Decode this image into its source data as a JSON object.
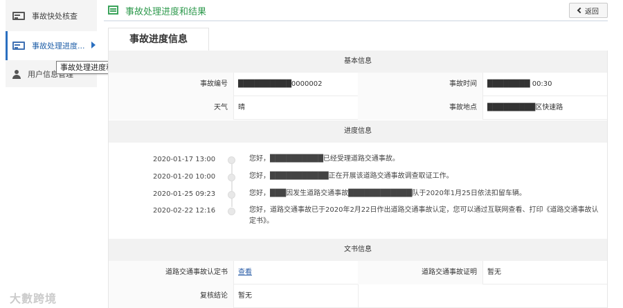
{
  "sidebar": {
    "items": [
      {
        "label": "事故快处核查",
        "icon": "id-card-icon"
      },
      {
        "label": "事故处理进度...",
        "icon": "id-card-icon"
      },
      {
        "label": "用户信息管理",
        "icon": "user-icon"
      }
    ],
    "tooltip": "事故处理进度和结果"
  },
  "header": {
    "title": "事故处理进度和结果",
    "back_label": "返回",
    "accent_color": "#2f9a4e"
  },
  "tab": {
    "label": "事故进度信息"
  },
  "basic": {
    "heading": "基本信息",
    "accident_no_label": "事故编号",
    "accident_no": "██████████0000002",
    "accident_time_label": "事故时间",
    "accident_time": "████████ 00:30",
    "weather_label": "天气",
    "weather": "晴",
    "location_label": "事故地点",
    "location": "█████████区快速路"
  },
  "progress": {
    "heading": "进度信息",
    "items": [
      {
        "date": "2020-01-17 13:00",
        "text": "您好，██████████已经受理道路交通事故。"
      },
      {
        "date": "2020-01-20 10:00",
        "text": "您好，███████████正在开展该道路交通事故调查取证工作。"
      },
      {
        "date": "2020-01-25 09:23",
        "text": "您好，███因发生道路交通事故████████████队于2020年1月25日依法扣留车辆。"
      },
      {
        "date": "2020-02-22 12:16",
        "text": "您好，道路交通事故已于2020年2月22日作出道路交通事故认定，您可以通过互联网查看、打印《道路交通事故认定书》。"
      }
    ]
  },
  "documents": {
    "heading": "文书信息",
    "cert_label": "道路交通事故认定书",
    "cert_value": "查看",
    "proof_label": "道路交通事故证明",
    "proof_value": "暂无",
    "review_label": "复核结论",
    "review_value": "暂无"
  },
  "watermark": "大數跨境"
}
